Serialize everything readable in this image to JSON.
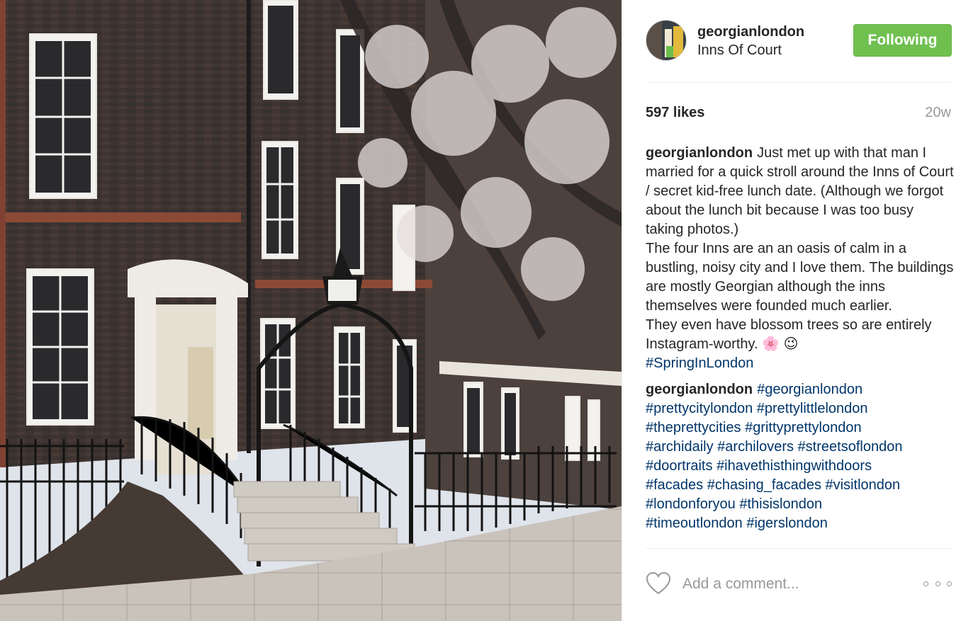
{
  "post": {
    "username": "georgianlondon",
    "location": "Inns Of Court",
    "follow_label": "Following",
    "likes": "597 likes",
    "timestamp": "20w"
  },
  "comments": [
    {
      "author": "georgianlondon",
      "text": "Just met up with that man I married for a quick stroll around the Inns of Court / secret kid-free lunch date. (Although we forgot about the lunch bit because I was too busy taking photos.)\nThe four Inns are an an oasis of calm in a bustling, noisy city and I love them. The buildings are mostly Georgian although the inns themselves were founded much earlier.\nThey even have blossom trees so are entirely Instagram-worthy. 🌸 😉",
      "tags": [
        "#SpringInLondon"
      ]
    },
    {
      "author": "georgianlondon",
      "text": "",
      "tags": [
        "#georgianlondon",
        "#prettycitylondon",
        "#prettylittlelondon",
        "#theprettycities",
        "#grittyprettylondon",
        "#archidaily",
        "#archilovers",
        "#streetsoflondon",
        "#doortraits",
        "#ihavethisthingwithdoors",
        "#facades",
        "#chasing_facades",
        "#visitlondon",
        "#londonforyou",
        "#thisislondon",
        "#timeoutlondon",
        "#igerslondon"
      ]
    }
  ],
  "footer": {
    "comment_placeholder": "Add a comment...",
    "like_icon": "heart-icon",
    "more_icon": "more-options-icon"
  },
  "colors": {
    "follow_button": "#70c050",
    "hashtag": "#003569",
    "muted": "#999999"
  }
}
